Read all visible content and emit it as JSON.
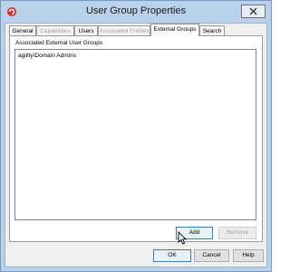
{
  "window": {
    "title": "User Group Properties",
    "close_icon": "close-icon",
    "app_icon": "app-icon"
  },
  "tabs": [
    {
      "label": "General",
      "state": "normal"
    },
    {
      "label": "Capabilities",
      "state": "disabled"
    },
    {
      "label": "Users",
      "state": "normal"
    },
    {
      "label": "Associated Entities",
      "state": "disabled"
    },
    {
      "label": "External Groups",
      "state": "active"
    },
    {
      "label": "Search",
      "state": "normal"
    }
  ],
  "panel": {
    "group_label": "Associated External User Groups",
    "items": [
      "agility\\Domain Admins"
    ],
    "add_label": "Add",
    "remove_label": "Remove"
  },
  "footer": {
    "ok_label": "OK",
    "cancel_label": "Cancel",
    "help_label": "Help"
  },
  "colors": {
    "frame": "#b9d1ea",
    "accent": "#3c7fb1",
    "app_icon": "#d0312d"
  }
}
